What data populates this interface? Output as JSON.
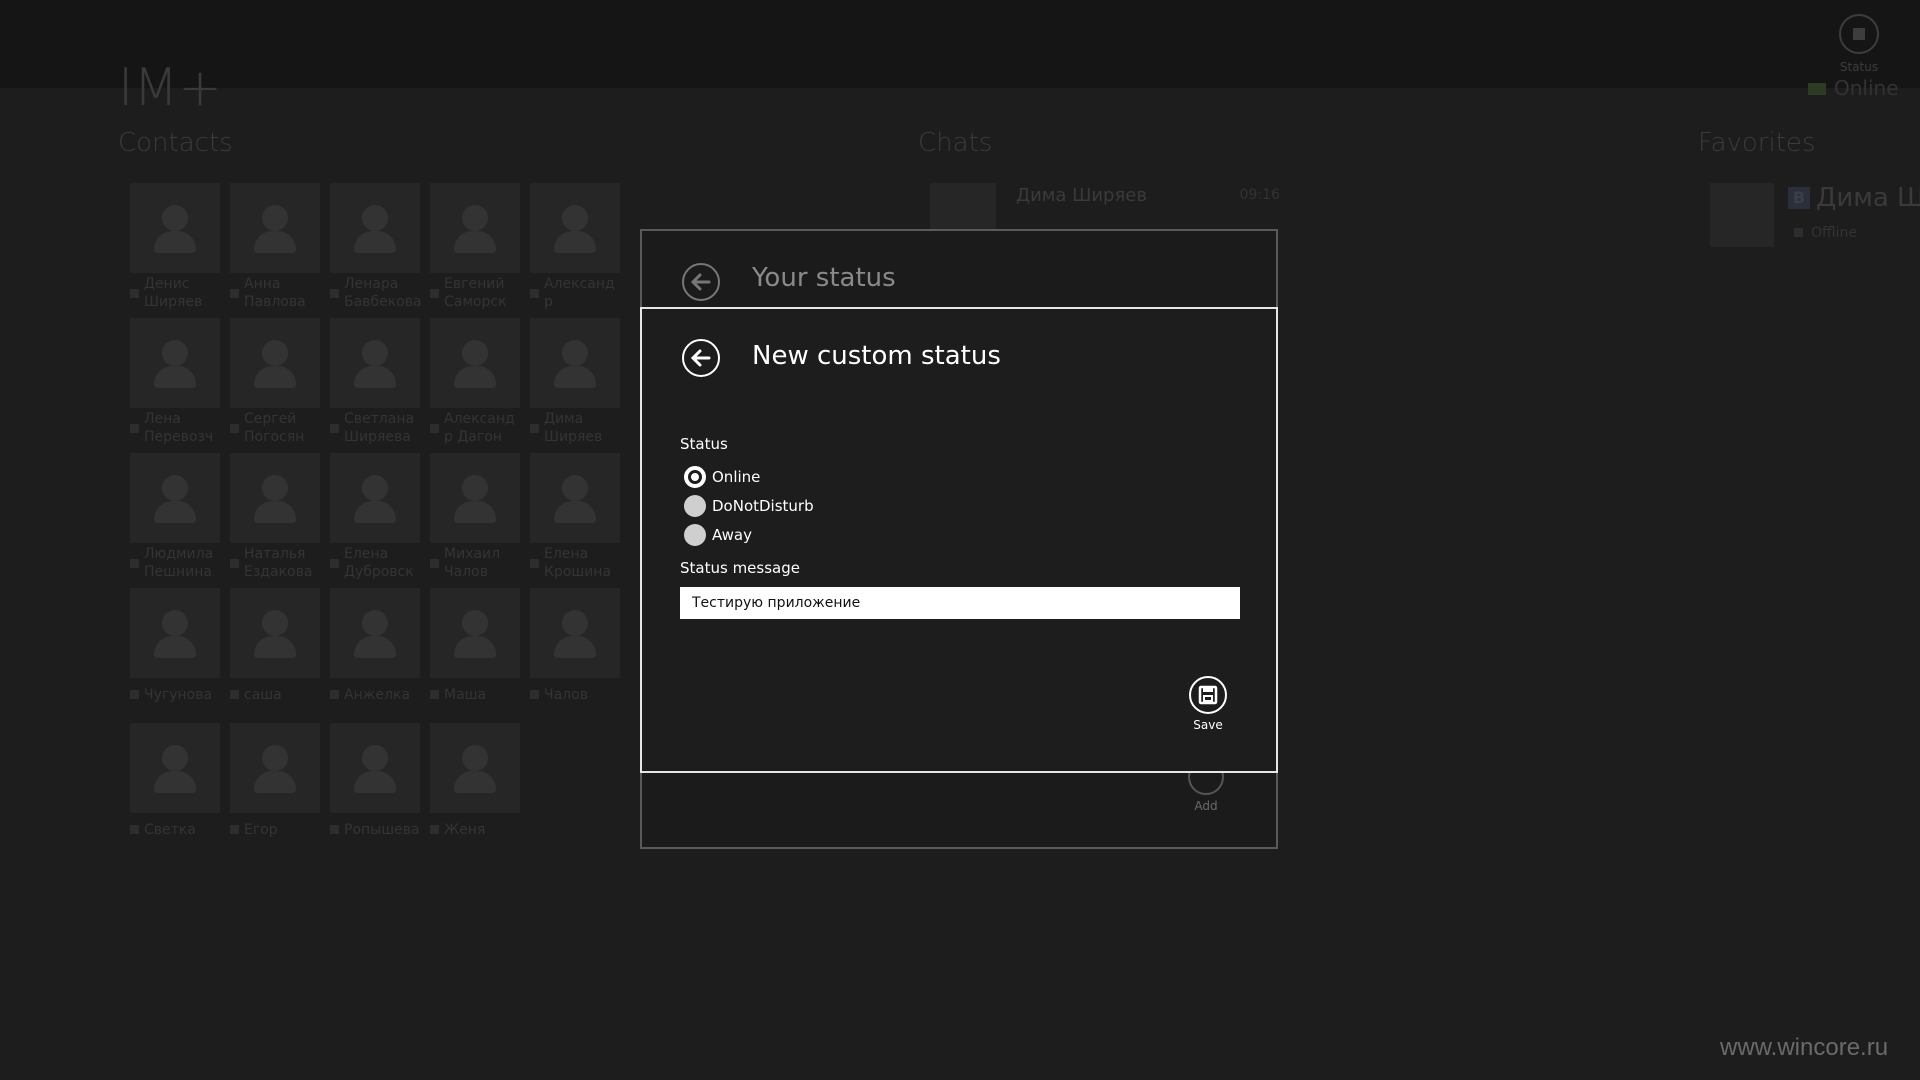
{
  "app": {
    "title": "IM+"
  },
  "topbar": {
    "status_label": "Status",
    "online_label": "Online"
  },
  "sections": {
    "contacts": "Contacts",
    "chats": "Chats",
    "favorites": "Favorites"
  },
  "contacts": [
    {
      "line1": "Денис",
      "line2": "Ширяев"
    },
    {
      "line1": "Анна",
      "line2": "Павлова"
    },
    {
      "line1": "Ленара",
      "line2": "Бавбекова"
    },
    {
      "line1": "Евгений",
      "line2": "Саморск"
    },
    {
      "line1": "Александ",
      "line2": "р"
    },
    {
      "line1": "Лена",
      "line2": "Перевозч"
    },
    {
      "line1": "Сергей",
      "line2": "Погосян"
    },
    {
      "line1": "Светлана",
      "line2": "Ширяева"
    },
    {
      "line1": "Александ",
      "line2": "р Дагон"
    },
    {
      "line1": "Дима",
      "line2": "Ширяев"
    },
    {
      "line1": "Людмила",
      "line2": "Пешнина"
    },
    {
      "line1": "Наталья",
      "line2": "Ездакова"
    },
    {
      "line1": "Елена",
      "line2": "Дубровск"
    },
    {
      "line1": "Михаил",
      "line2": "Чалов"
    },
    {
      "line1": "Елена",
      "line2": "Крошина"
    },
    {
      "line1": "Чугунова",
      "line2": ""
    },
    {
      "line1": "саша",
      "line2": ""
    },
    {
      "line1": "Анжелка",
      "line2": ""
    },
    {
      "line1": "Маша",
      "line2": ""
    },
    {
      "line1": "Чалов",
      "line2": ""
    },
    {
      "line1": "Светка",
      "line2": ""
    },
    {
      "line1": "Егор",
      "line2": ""
    },
    {
      "line1": "Ропышева",
      "line2": ""
    },
    {
      "line1": "Женя",
      "line2": ""
    }
  ],
  "chats": [
    {
      "name": "Дима Ширяев",
      "time": "09:16"
    }
  ],
  "favorites": [
    {
      "badge": "В",
      "name": "Дима Ши",
      "status": "Offline"
    }
  ],
  "your_status_dialog": {
    "title": "Your status",
    "add_label": "Add"
  },
  "custom_status_dialog": {
    "title": "New custom status",
    "status_label": "Status",
    "options": [
      "Online",
      "DoNotDisturb",
      "Away"
    ],
    "selected": "Online",
    "message_label": "Status message",
    "message_value": "Тестирую приложение",
    "save_label": "Save"
  },
  "watermark": "www.wincore.ru"
}
